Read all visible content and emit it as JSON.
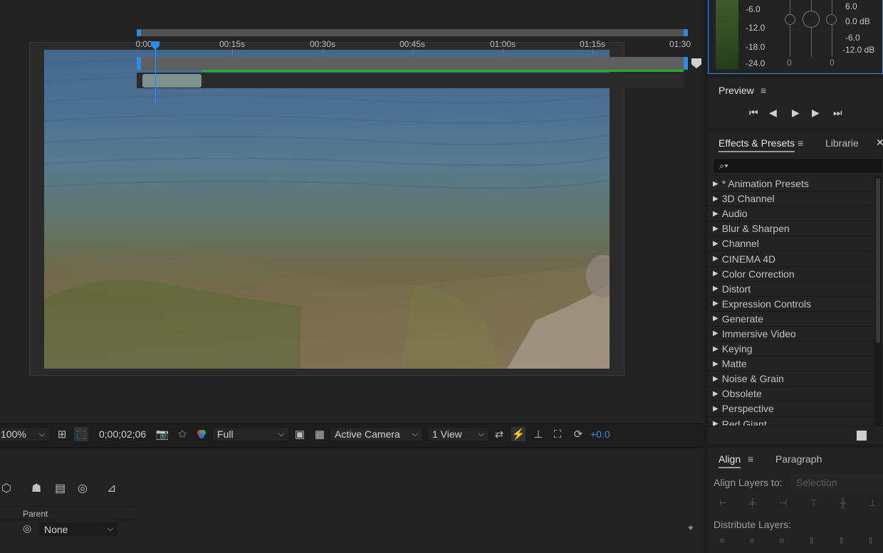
{
  "viewer": {
    "zoom": "100%",
    "timecode": "0;00;02;06",
    "resolution": "Full",
    "camera": "Active Camera",
    "views": "1 View",
    "exposure": "+0.0"
  },
  "audio": {
    "meter_labels": [
      "-6.0",
      "-12.0",
      "-18.0",
      "-24.0"
    ],
    "level_right": [
      "6.0",
      "0.0 dB",
      "-6.0",
      "-12.0 dB"
    ],
    "channel_values": [
      "0",
      "0"
    ]
  },
  "preview": {
    "title": "Preview"
  },
  "effects": {
    "tab_active": "Effects & Presets",
    "tab_other": "Librarie",
    "items": [
      "* Animation Presets",
      "3D Channel",
      "Audio",
      "Blur & Sharpen",
      "Channel",
      "CINEMA 4D",
      "Color Correction",
      "Distort",
      "Expression Controls",
      "Generate",
      "Immersive Video",
      "Keying",
      "Matte",
      "Noise & Grain",
      "Obsolete",
      "Perspective",
      "Red Giant"
    ]
  },
  "align": {
    "tab_active": "Align",
    "tab_other": "Paragraph",
    "align_to_label": "Align Layers to:",
    "align_to_value": "Selection",
    "distribute_label": "Distribute Layers:"
  },
  "timeline": {
    "ruler_labels": [
      "0:00",
      "00:15s",
      "00:30s",
      "00:45s",
      "01:00s",
      "01:15s",
      "01:30"
    ],
    "parent_header": "Parent",
    "parent_value": "None"
  },
  "colors": {
    "accent": "#2d8ceb",
    "work_area": "#21b02d",
    "clip": "#7d928f"
  }
}
